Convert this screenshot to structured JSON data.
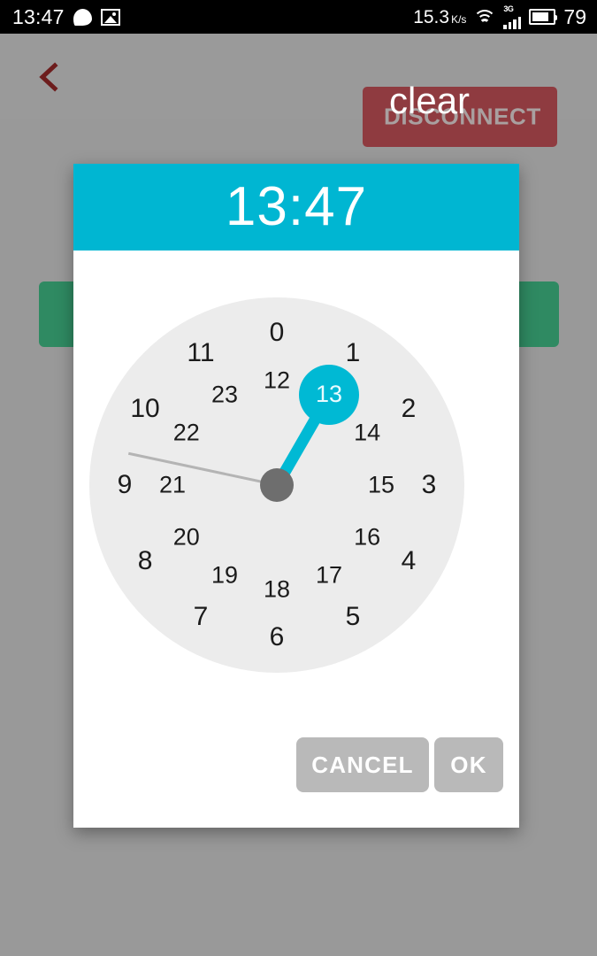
{
  "status_bar": {
    "clock": "13:47",
    "message_icon": "message-bubble-icon",
    "gallery_icon": "image-icon",
    "network_speed": "15.3",
    "network_speed_unit": "K/s",
    "wifi_icon": "wifi-icon",
    "mobile_network": "3G",
    "signal_icon": "signal-bars-icon",
    "battery_icon": "battery-icon",
    "battery_level": "79"
  },
  "app_bar": {
    "back_icon": "back-chevron-icon",
    "disconnect_label": "DISCONNECT",
    "overlay_label": "clear"
  },
  "dialog": {
    "time_title": "13:47",
    "cancel_label": "CANCEL",
    "ok_label": "OK",
    "selected_value": "13",
    "outer_ring": [
      "0",
      "1",
      "2",
      "3",
      "4",
      "5",
      "6",
      "7",
      "8",
      "9",
      "10",
      "11"
    ],
    "inner_ring": [
      "12",
      "13",
      "14",
      "15",
      "16",
      "17",
      "18",
      "19",
      "20",
      "21",
      "22",
      "23"
    ],
    "hour_hand_value": 13,
    "minute_hand_value": 47
  },
  "background": {
    "chip_left": "green-chip",
    "chip_right": "green-chip"
  },
  "colors": {
    "accent_cyan": "#00b6d2",
    "selection_cyan": "#00b9d4",
    "disconnect_red": "#8f3b40",
    "chip_green": "#2f8a62",
    "page_grey": "#999999",
    "clockface_grey": "#ececec",
    "hub_grey": "#6e6e6e",
    "button_grey": "#b9b9b9"
  }
}
